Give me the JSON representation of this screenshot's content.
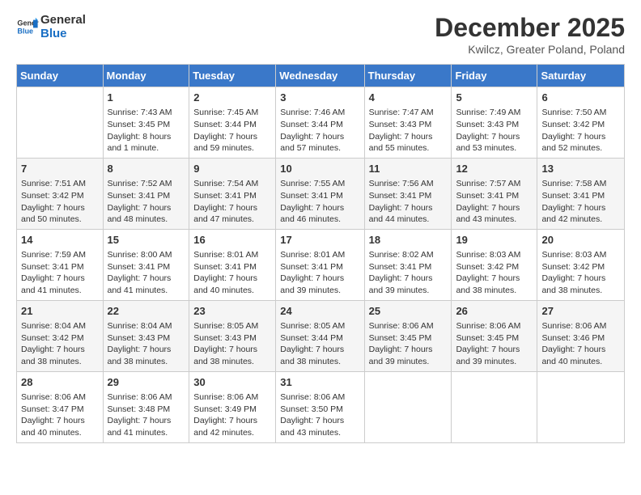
{
  "logo": {
    "line1": "General",
    "line2": "Blue"
  },
  "title": "December 2025",
  "location": "Kwilcz, Greater Poland, Poland",
  "days_of_week": [
    "Sunday",
    "Monday",
    "Tuesday",
    "Wednesday",
    "Thursday",
    "Friday",
    "Saturday"
  ],
  "weeks": [
    [
      {
        "day": "",
        "info": ""
      },
      {
        "day": "1",
        "info": "Sunrise: 7:43 AM\nSunset: 3:45 PM\nDaylight: 8 hours\nand 1 minute."
      },
      {
        "day": "2",
        "info": "Sunrise: 7:45 AM\nSunset: 3:44 PM\nDaylight: 7 hours\nand 59 minutes."
      },
      {
        "day": "3",
        "info": "Sunrise: 7:46 AM\nSunset: 3:44 PM\nDaylight: 7 hours\nand 57 minutes."
      },
      {
        "day": "4",
        "info": "Sunrise: 7:47 AM\nSunset: 3:43 PM\nDaylight: 7 hours\nand 55 minutes."
      },
      {
        "day": "5",
        "info": "Sunrise: 7:49 AM\nSunset: 3:43 PM\nDaylight: 7 hours\nand 53 minutes."
      },
      {
        "day": "6",
        "info": "Sunrise: 7:50 AM\nSunset: 3:42 PM\nDaylight: 7 hours\nand 52 minutes."
      }
    ],
    [
      {
        "day": "7",
        "info": "Sunrise: 7:51 AM\nSunset: 3:42 PM\nDaylight: 7 hours\nand 50 minutes."
      },
      {
        "day": "8",
        "info": "Sunrise: 7:52 AM\nSunset: 3:41 PM\nDaylight: 7 hours\nand 48 minutes."
      },
      {
        "day": "9",
        "info": "Sunrise: 7:54 AM\nSunset: 3:41 PM\nDaylight: 7 hours\nand 47 minutes."
      },
      {
        "day": "10",
        "info": "Sunrise: 7:55 AM\nSunset: 3:41 PM\nDaylight: 7 hours\nand 46 minutes."
      },
      {
        "day": "11",
        "info": "Sunrise: 7:56 AM\nSunset: 3:41 PM\nDaylight: 7 hours\nand 44 minutes."
      },
      {
        "day": "12",
        "info": "Sunrise: 7:57 AM\nSunset: 3:41 PM\nDaylight: 7 hours\nand 43 minutes."
      },
      {
        "day": "13",
        "info": "Sunrise: 7:58 AM\nSunset: 3:41 PM\nDaylight: 7 hours\nand 42 minutes."
      }
    ],
    [
      {
        "day": "14",
        "info": "Sunrise: 7:59 AM\nSunset: 3:41 PM\nDaylight: 7 hours\nand 41 minutes."
      },
      {
        "day": "15",
        "info": "Sunrise: 8:00 AM\nSunset: 3:41 PM\nDaylight: 7 hours\nand 41 minutes."
      },
      {
        "day": "16",
        "info": "Sunrise: 8:01 AM\nSunset: 3:41 PM\nDaylight: 7 hours\nand 40 minutes."
      },
      {
        "day": "17",
        "info": "Sunrise: 8:01 AM\nSunset: 3:41 PM\nDaylight: 7 hours\nand 39 minutes."
      },
      {
        "day": "18",
        "info": "Sunrise: 8:02 AM\nSunset: 3:41 PM\nDaylight: 7 hours\nand 39 minutes."
      },
      {
        "day": "19",
        "info": "Sunrise: 8:03 AM\nSunset: 3:42 PM\nDaylight: 7 hours\nand 38 minutes."
      },
      {
        "day": "20",
        "info": "Sunrise: 8:03 AM\nSunset: 3:42 PM\nDaylight: 7 hours\nand 38 minutes."
      }
    ],
    [
      {
        "day": "21",
        "info": "Sunrise: 8:04 AM\nSunset: 3:42 PM\nDaylight: 7 hours\nand 38 minutes."
      },
      {
        "day": "22",
        "info": "Sunrise: 8:04 AM\nSunset: 3:43 PM\nDaylight: 7 hours\nand 38 minutes."
      },
      {
        "day": "23",
        "info": "Sunrise: 8:05 AM\nSunset: 3:43 PM\nDaylight: 7 hours\nand 38 minutes."
      },
      {
        "day": "24",
        "info": "Sunrise: 8:05 AM\nSunset: 3:44 PM\nDaylight: 7 hours\nand 38 minutes."
      },
      {
        "day": "25",
        "info": "Sunrise: 8:06 AM\nSunset: 3:45 PM\nDaylight: 7 hours\nand 39 minutes."
      },
      {
        "day": "26",
        "info": "Sunrise: 8:06 AM\nSunset: 3:45 PM\nDaylight: 7 hours\nand 39 minutes."
      },
      {
        "day": "27",
        "info": "Sunrise: 8:06 AM\nSunset: 3:46 PM\nDaylight: 7 hours\nand 40 minutes."
      }
    ],
    [
      {
        "day": "28",
        "info": "Sunrise: 8:06 AM\nSunset: 3:47 PM\nDaylight: 7 hours\nand 40 minutes."
      },
      {
        "day": "29",
        "info": "Sunrise: 8:06 AM\nSunset: 3:48 PM\nDaylight: 7 hours\nand 41 minutes."
      },
      {
        "day": "30",
        "info": "Sunrise: 8:06 AM\nSunset: 3:49 PM\nDaylight: 7 hours\nand 42 minutes."
      },
      {
        "day": "31",
        "info": "Sunrise: 8:06 AM\nSunset: 3:50 PM\nDaylight: 7 hours\nand 43 minutes."
      },
      {
        "day": "",
        "info": ""
      },
      {
        "day": "",
        "info": ""
      },
      {
        "day": "",
        "info": ""
      }
    ]
  ]
}
